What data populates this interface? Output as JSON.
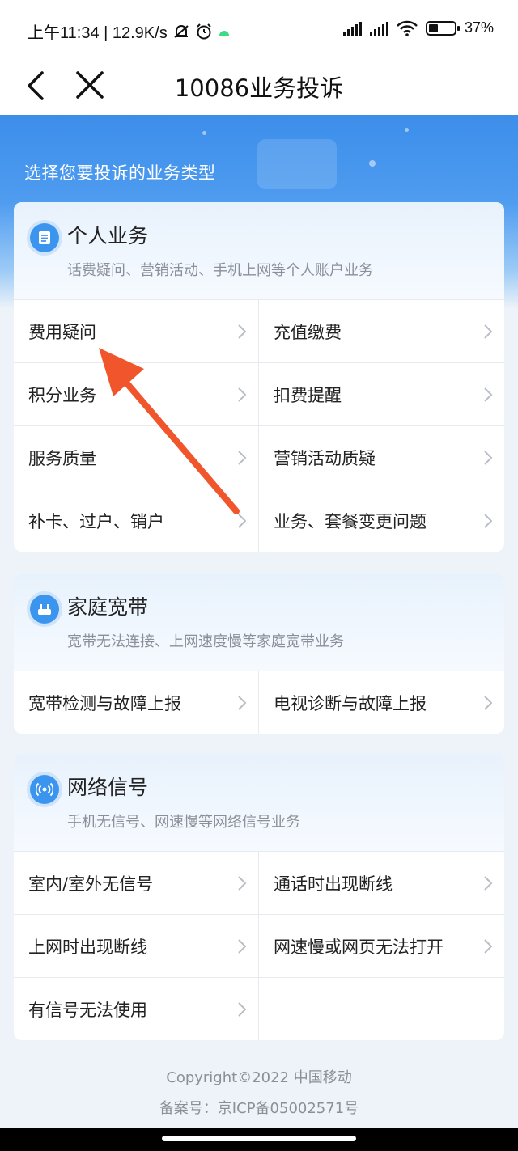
{
  "status_bar": {
    "time_speed": "上午11:34 | 12.9K/s",
    "battery": "37%",
    "battery_level": 0.37
  },
  "nav": {
    "title": "10086业务投诉"
  },
  "hero": {
    "prompt": "选择您要投诉的业务类型"
  },
  "sections": [
    {
      "title": "个人业务",
      "subtitle": "话费疑问、营销活动、手机上网等个人账户业务",
      "icon": "document-icon",
      "items": [
        "费用疑问",
        "充值缴费",
        "积分业务",
        "扣费提醒",
        "服务质量",
        "营销活动质疑",
        "补卡、过户、销户",
        "业务、套餐变更问题"
      ]
    },
    {
      "title": "家庭宽带",
      "subtitle": "宽带无法连接、上网速度慢等家庭宽带业务",
      "icon": "router-icon",
      "items": [
        "宽带检测与故障上报",
        "电视诊断与故障上报"
      ]
    },
    {
      "title": "网络信号",
      "subtitle": "手机无信号、网速慢等网络信号业务",
      "icon": "signal-icon",
      "items": [
        "室内/室外无信号",
        "通话时出现断线",
        "上网时出现断线",
        "网速慢或网页无法打开",
        "有信号无法使用"
      ]
    }
  ],
  "footer": {
    "copyright": "Copyright©2022 中国移动",
    "icp": "备案号：京ICP备05002571号"
  },
  "colors": {
    "accent": "#3b94ee",
    "annotation_arrow": "#f0552b"
  }
}
